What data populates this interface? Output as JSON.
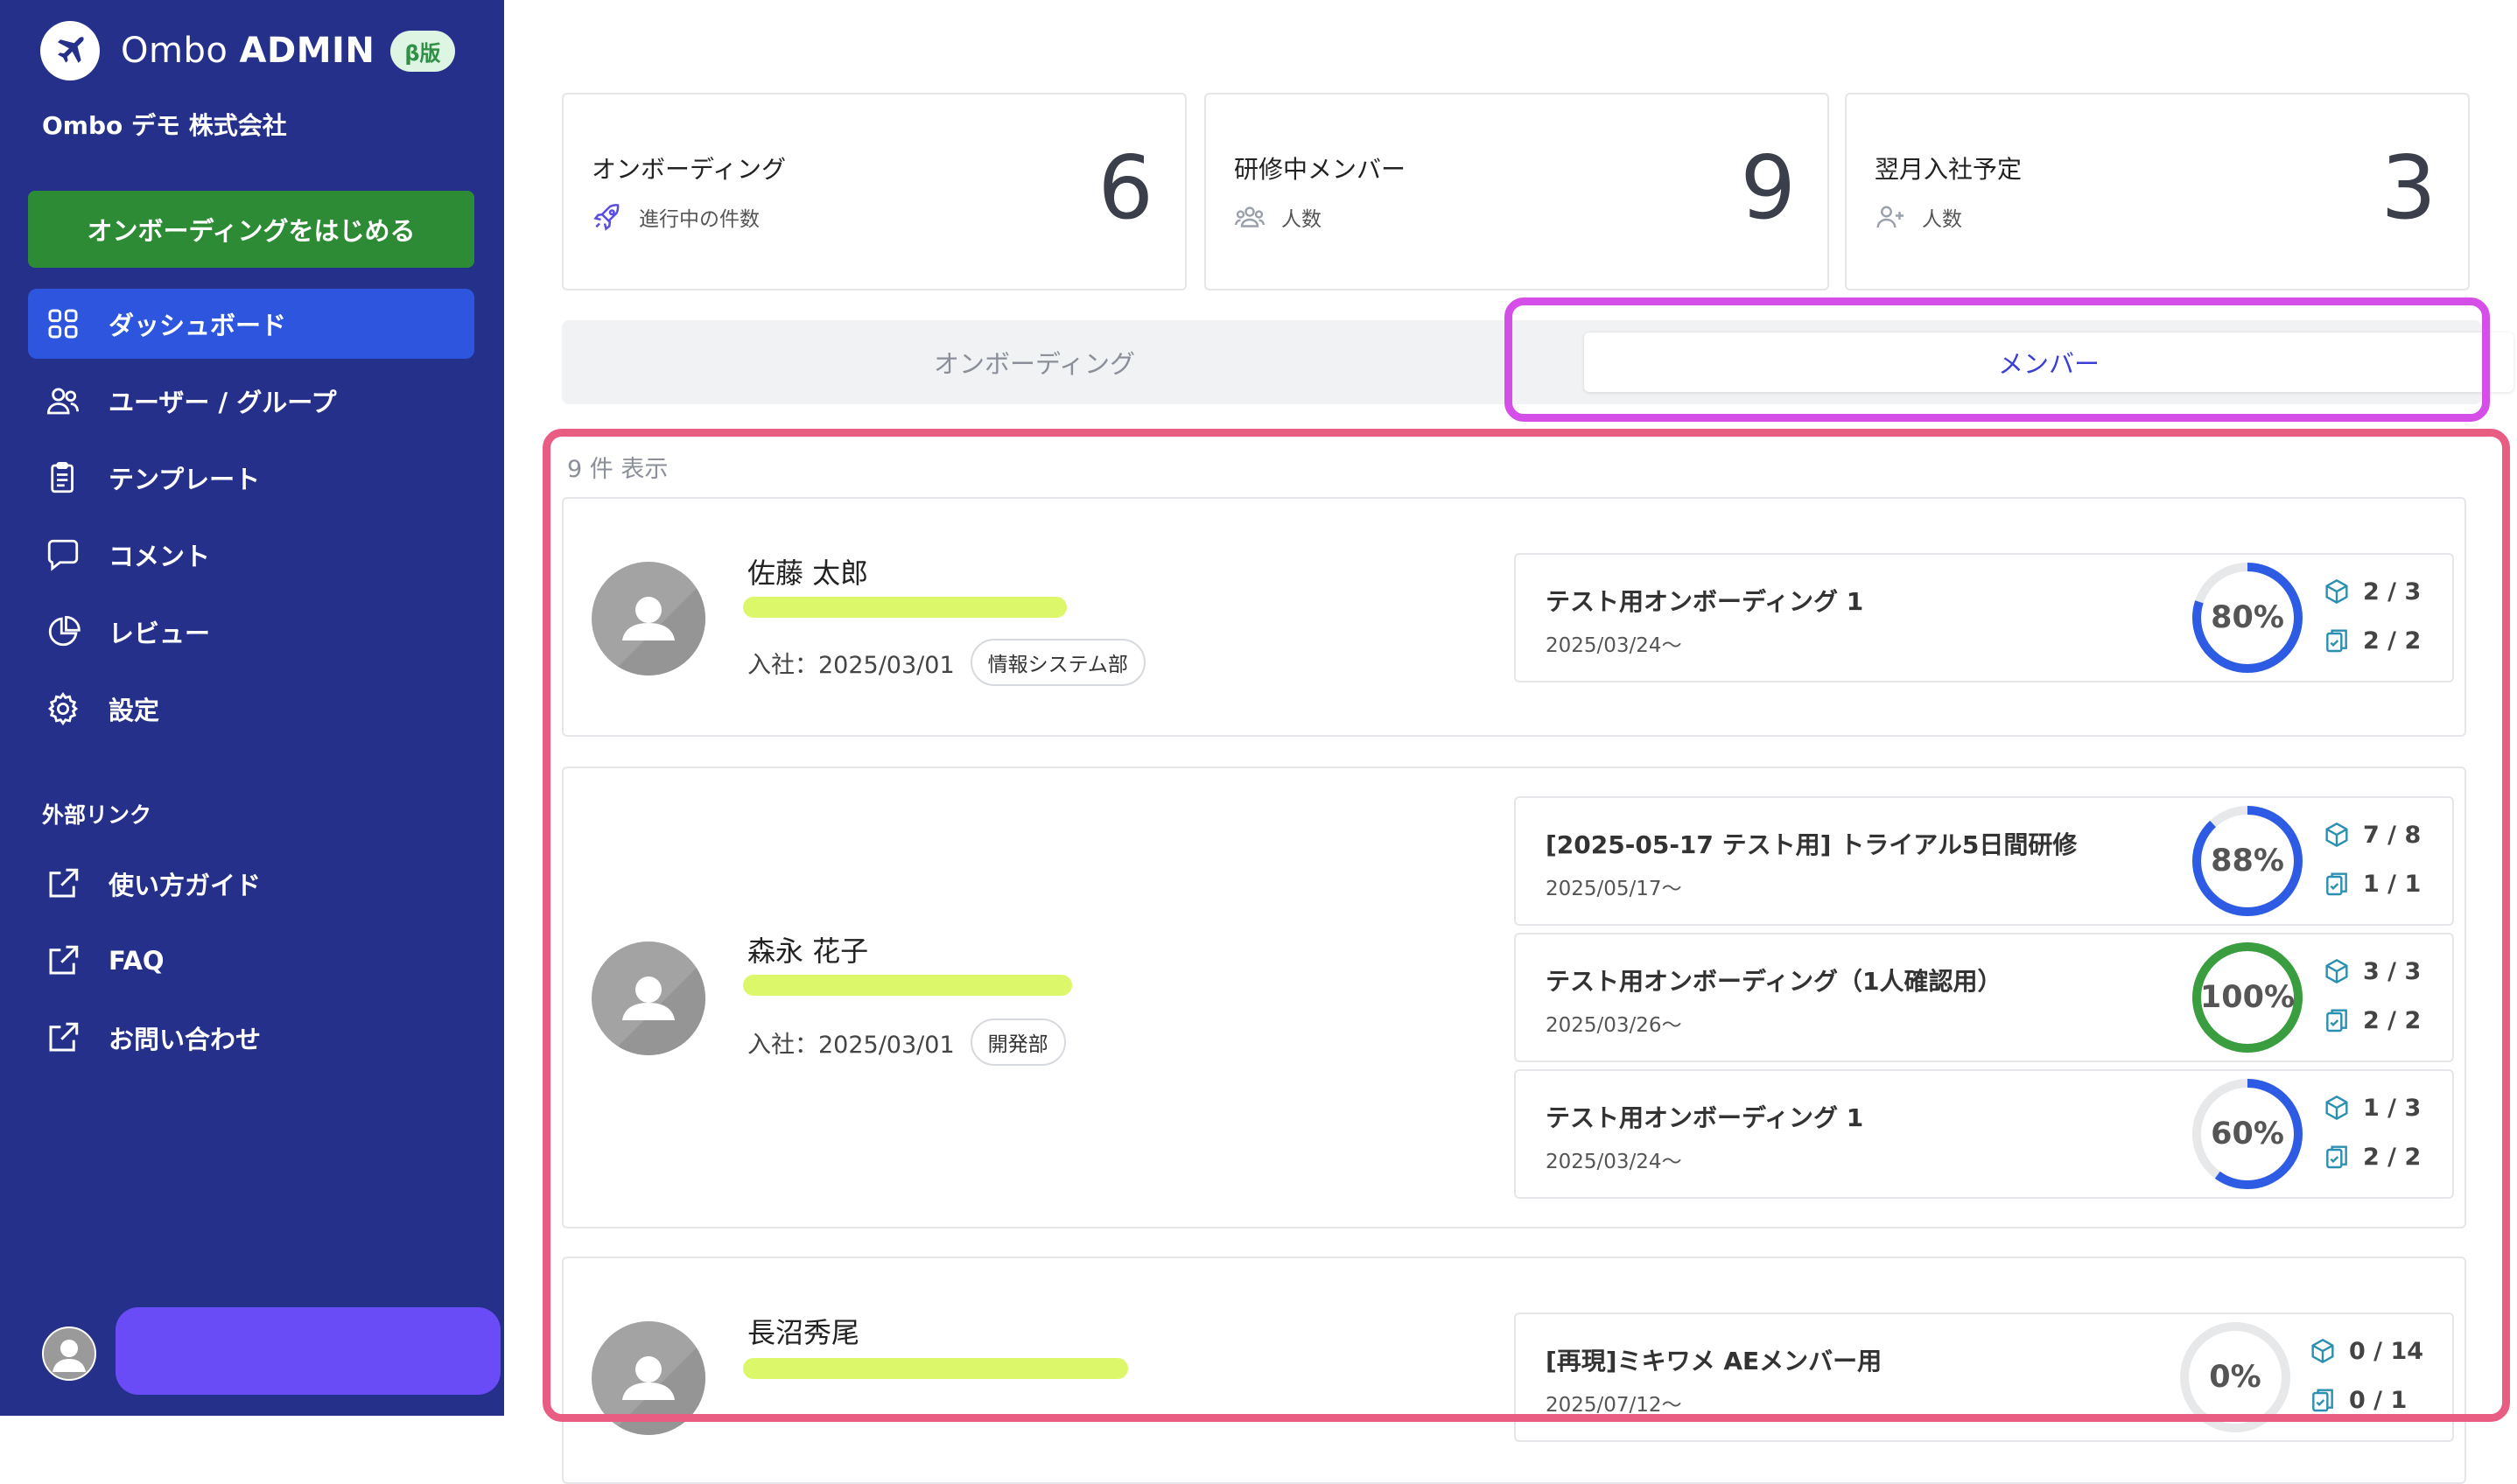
{
  "app": {
    "logo_light": "Ombo",
    "logo_bold": "ADMIN",
    "beta": "β版",
    "company": "Ombo デモ 株式会社",
    "start_button": "オンボーディングをはじめる"
  },
  "sidebar": {
    "items": [
      {
        "label": "ダッシュボード",
        "icon": "grid-icon"
      },
      {
        "label": "ユーザー / グループ",
        "icon": "users-icon"
      },
      {
        "label": "テンプレート",
        "icon": "clipboard-icon"
      },
      {
        "label": "コメント",
        "icon": "comment-icon"
      },
      {
        "label": "レビュー",
        "icon": "pie-chart-icon"
      },
      {
        "label": "設定",
        "icon": "gear-icon"
      }
    ],
    "external_heading": "外部リンク",
    "external": [
      {
        "label": "使い方ガイド",
        "icon": "external-link-icon"
      },
      {
        "label": "FAQ",
        "icon": "external-link-icon"
      },
      {
        "label": "お問い合わせ",
        "icon": "external-link-icon"
      }
    ]
  },
  "stats": [
    {
      "label": "オンボーディング",
      "sub": "進行中の件数",
      "value": "6",
      "icon": "rocket-icon"
    },
    {
      "label": "研修中メンバー",
      "sub": "人数",
      "value": "9",
      "icon": "group-icon"
    },
    {
      "label": "翌月入社予定",
      "sub": "人数",
      "value": "3",
      "icon": "user-plus-icon"
    }
  ],
  "tabs": {
    "onboarding": "オンボーディング",
    "members": "メンバー"
  },
  "list": {
    "count": "9 件 表示"
  },
  "members": [
    {
      "name": "佐藤 太郎",
      "join": "入社：2025/03/01",
      "dept": "情報システム部",
      "onboardings": [
        {
          "title": "テスト用オンボーディング 1",
          "date": "2025/03/24〜",
          "percent_label": "80%",
          "progress": 0.8,
          "color": "#2d5be3",
          "tasks": "2 / 3",
          "docs": "2 / 2"
        }
      ]
    },
    {
      "name": "森永 花子",
      "join": "入社：2025/03/01",
      "dept": "開発部",
      "onboardings": [
        {
          "title": "[2025-05-17 テスト用] トライアル5日間研修",
          "date": "2025/05/17〜",
          "percent_label": "88%",
          "progress": 0.88,
          "color": "#2d5be3",
          "tasks": "7 / 8",
          "docs": "1 / 1"
        },
        {
          "title": "テスト用オンボーディング（1人確認用）",
          "date": "2025/03/26〜",
          "percent_label": "100%",
          "progress": 1.0,
          "color": "#3a9d3f",
          "tasks": "3 / 3",
          "docs": "2 / 2"
        },
        {
          "title": "テスト用オンボーディング 1",
          "date": "2025/03/24〜",
          "percent_label": "60%",
          "progress": 0.6,
          "color": "#2d5be3",
          "tasks": "1 / 3",
          "docs": "2 / 2"
        }
      ]
    },
    {
      "name": "長沼秀尾",
      "join": "",
      "dept": "",
      "onboardings": [
        {
          "title": "[再現]ミキワメ AEメンバー用",
          "date": "2025/07/12〜",
          "percent_label": "0%",
          "progress": 0.0,
          "color": "#2d5be3",
          "tasks": "0 / 14",
          "docs": "0 / 1"
        }
      ]
    }
  ]
}
